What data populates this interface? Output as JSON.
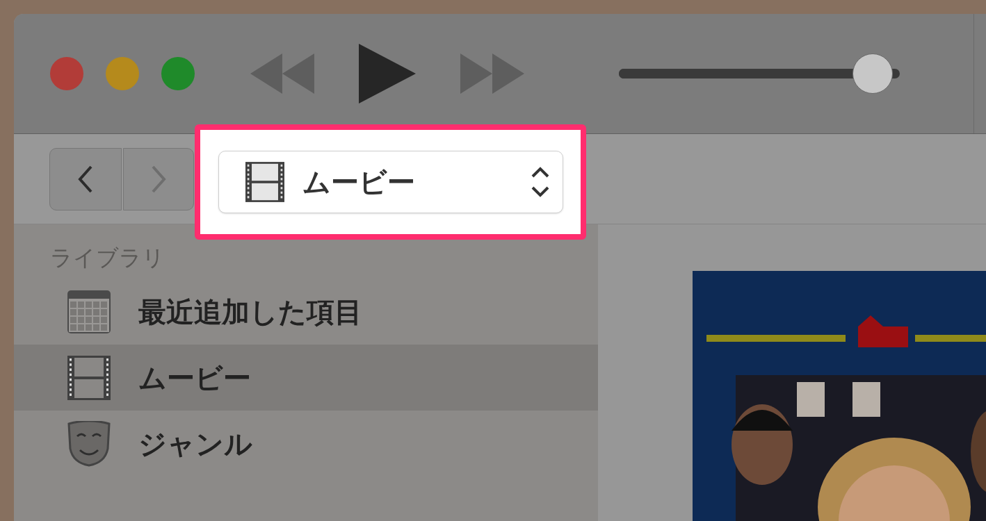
{
  "window_controls": [
    {
      "color": "#b23c38"
    },
    {
      "color": "#b58a1c"
    },
    {
      "color": "#1f8a2a"
    }
  ],
  "player": {
    "volume": {
      "level": 0.97
    }
  },
  "navigation": {
    "back": {
      "disabled": false
    },
    "forward": {
      "disabled": true
    }
  },
  "media_picker": {
    "label": "ムービー",
    "kind": "movies",
    "highlighted": true
  },
  "sidebar": {
    "header": "ライブラリ",
    "items": [
      {
        "label": "最近追加した項目",
        "kind": "recent",
        "selected": false
      },
      {
        "label": "ムービー",
        "kind": "movies",
        "selected": true
      },
      {
        "label": "ジャンル",
        "kind": "genres",
        "selected": false
      }
    ]
  }
}
